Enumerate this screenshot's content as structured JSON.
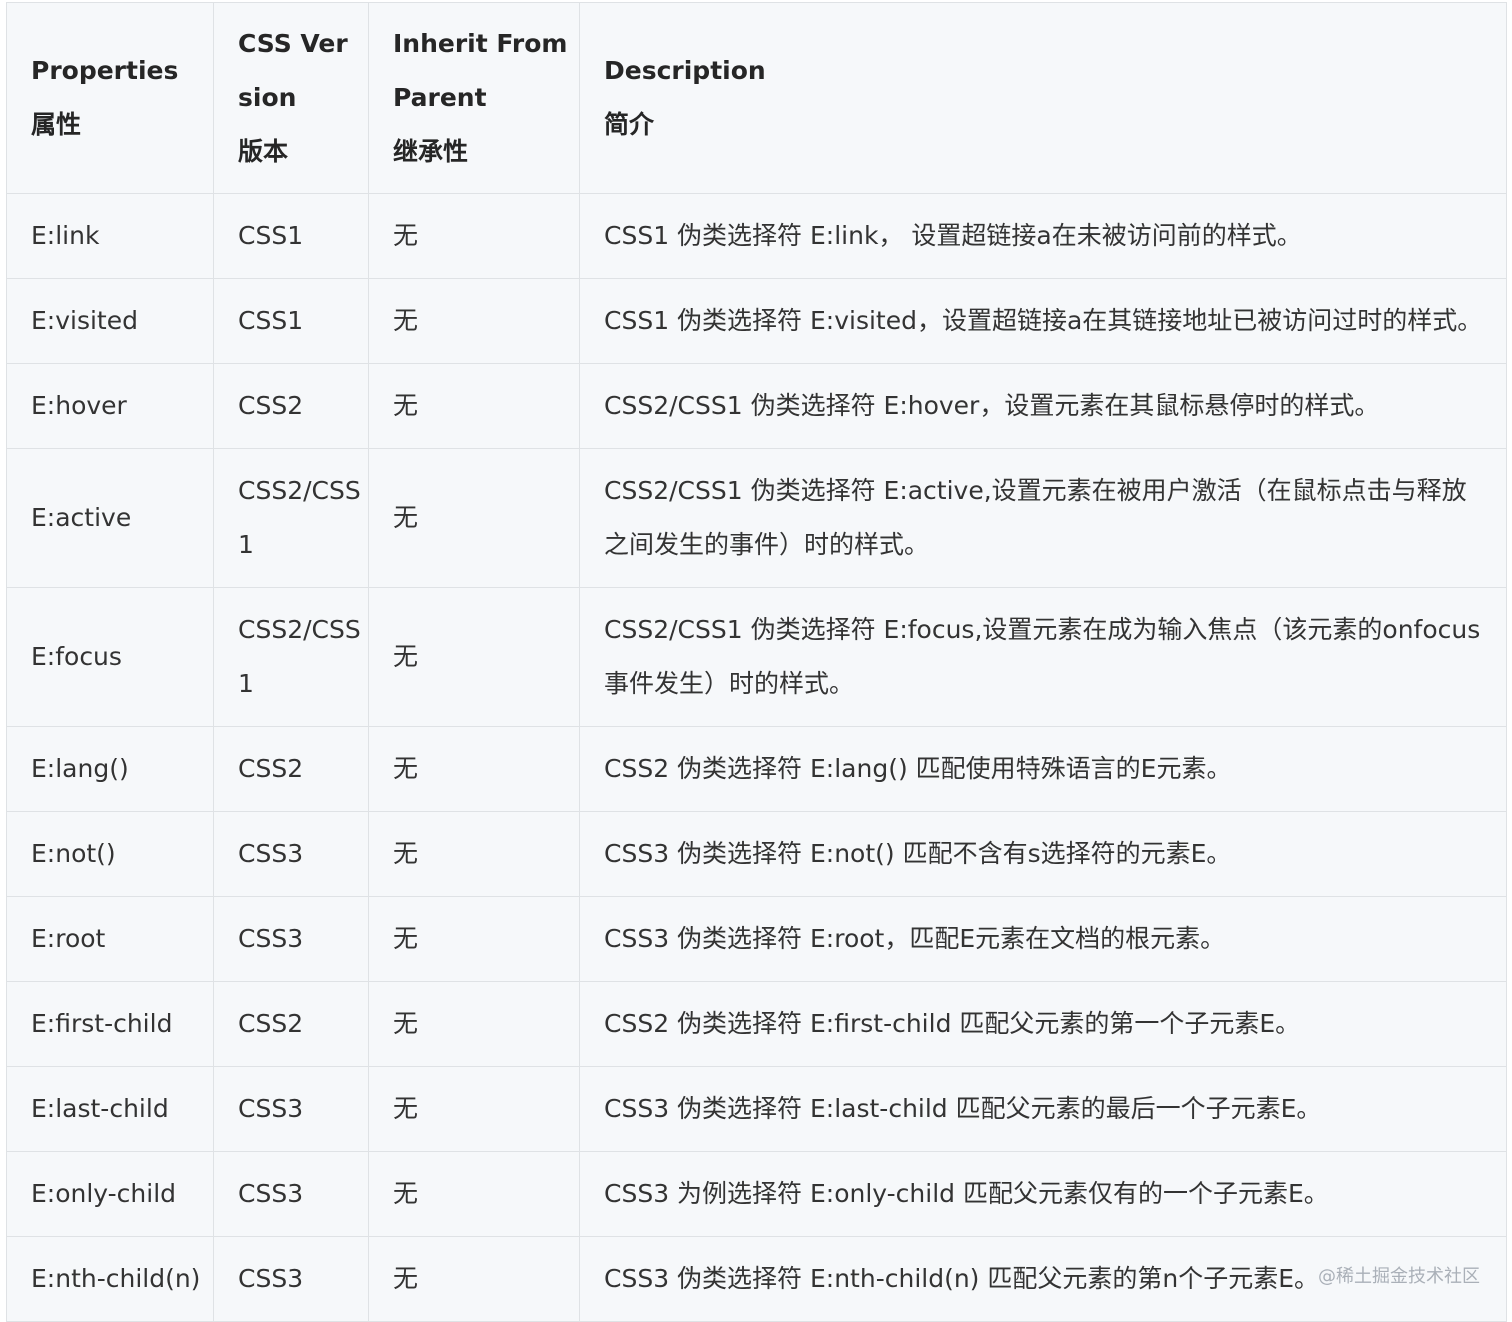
{
  "header": {
    "properties": [
      "Properties",
      "属性"
    ],
    "version": [
      "CSS Ver",
      "sion",
      "版本"
    ],
    "inherit": [
      "Inherit From",
      "Parent",
      "继承性"
    ],
    "description": [
      "Description",
      "简介"
    ]
  },
  "rows": [
    {
      "property": "E:link",
      "version": "CSS1",
      "inherit": "无",
      "description": "CSS1 伪类选择符 E:link， 设置超链接a在未被访问前的样式。"
    },
    {
      "property": "E:visited",
      "version": "CSS1",
      "inherit": "无",
      "description": "CSS1 伪类选择符 E:visited，设置超链接a在其链接地址已被访问过时的样式。"
    },
    {
      "property": "E:hover",
      "version": "CSS2",
      "inherit": "无",
      "description": "CSS2/CSS1 伪类选择符 E:hover，设置元素在其鼠标悬停时的样式。"
    },
    {
      "property": "E:active",
      "version": "CSS2/CSS1",
      "inherit": "无",
      "description": "CSS2/CSS1 伪类选择符 E:active,设置元素在被用户激活（在鼠标点击与释放之间发生的事件）时的样式。"
    },
    {
      "property": "E:focus",
      "version": "CSS2/CSS1",
      "inherit": "无",
      "description": "CSS2/CSS1 伪类选择符 E:focus,设置元素在成为输入焦点（该元素的onfocus事件发生）时的样式。"
    },
    {
      "property": "E:lang()",
      "version": "CSS2",
      "inherit": "无",
      "description": "CSS2 伪类选择符 E:lang() 匹配使用特殊语言的E元素。"
    },
    {
      "property": "E:not()",
      "version": "CSS3",
      "inherit": "无",
      "description": "CSS3 伪类选择符 E:not() 匹配不含有s选择符的元素E。"
    },
    {
      "property": "E:root",
      "version": "CSS3",
      "inherit": "无",
      "description": "CSS3 伪类选择符 E:root，匹配E元素在文档的根元素。"
    },
    {
      "property": "E:first-child",
      "version": "CSS2",
      "inherit": "无",
      "description": "CSS2 伪类选择符 E:first-child 匹配父元素的第一个子元素E。"
    },
    {
      "property": "E:last-child",
      "version": "CSS3",
      "inherit": "无",
      "description": "CSS3 伪类选择符 E:last-child 匹配父元素的最后一个子元素E。"
    },
    {
      "property": "E:only-child",
      "version": "CSS3",
      "inherit": "无",
      "description": "CSS3 为例选择符 E:only-child 匹配父元素仅有的一个子元素E。"
    },
    {
      "property": "E:nth-child(n)",
      "version": "CSS3",
      "inherit": "无",
      "description": "CSS3 伪类选择符 E:nth-child(n) 匹配父元素的第n个子元素E。"
    }
  ],
  "watermark": "@稀土掘金技术社区"
}
